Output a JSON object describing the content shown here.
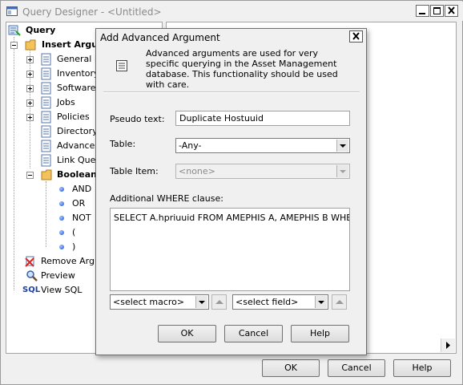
{
  "main": {
    "title": "Query Designer - <Untitled>",
    "ok_label": "OK",
    "cancel_label": "Cancel",
    "help_label": "Help"
  },
  "tree": {
    "root": "Query",
    "insert_argument": "Insert Argum",
    "items": [
      "General In",
      "Inventory",
      "Software",
      "Jobs",
      "Policies",
      "Directory C",
      "Advanced",
      "Link Query"
    ],
    "boolean": "Boolean",
    "boolean_items": [
      "AND",
      "OR",
      "NOT",
      "(",
      ")"
    ],
    "remove_argument": "Remove Argum",
    "preview": "Preview",
    "view_sql": "View SQL",
    "sql_badge": "SQL"
  },
  "dialog": {
    "title": "Add Advanced Argument",
    "info": "Advanced arguments are used for very specific querying in the Asset Management database. This functionality should be used with care.",
    "pseudo_label": "Pseudo text:",
    "pseudo_value": "Duplicate Hostuuid",
    "table_label": "Table:",
    "table_value": "-Any-",
    "table_item_label": "Table Item:",
    "table_item_value": "<none>",
    "where_label": "Additional WHERE clause:",
    "where_value": "SELECT A.hpriuuid FROM AMEPHIS A, AMEPHIS B WHERE A.",
    "macro_value": "<select macro>",
    "field_value": "<select field>",
    "ok_label": "OK",
    "cancel_label": "Cancel",
    "help_label": "Help"
  }
}
